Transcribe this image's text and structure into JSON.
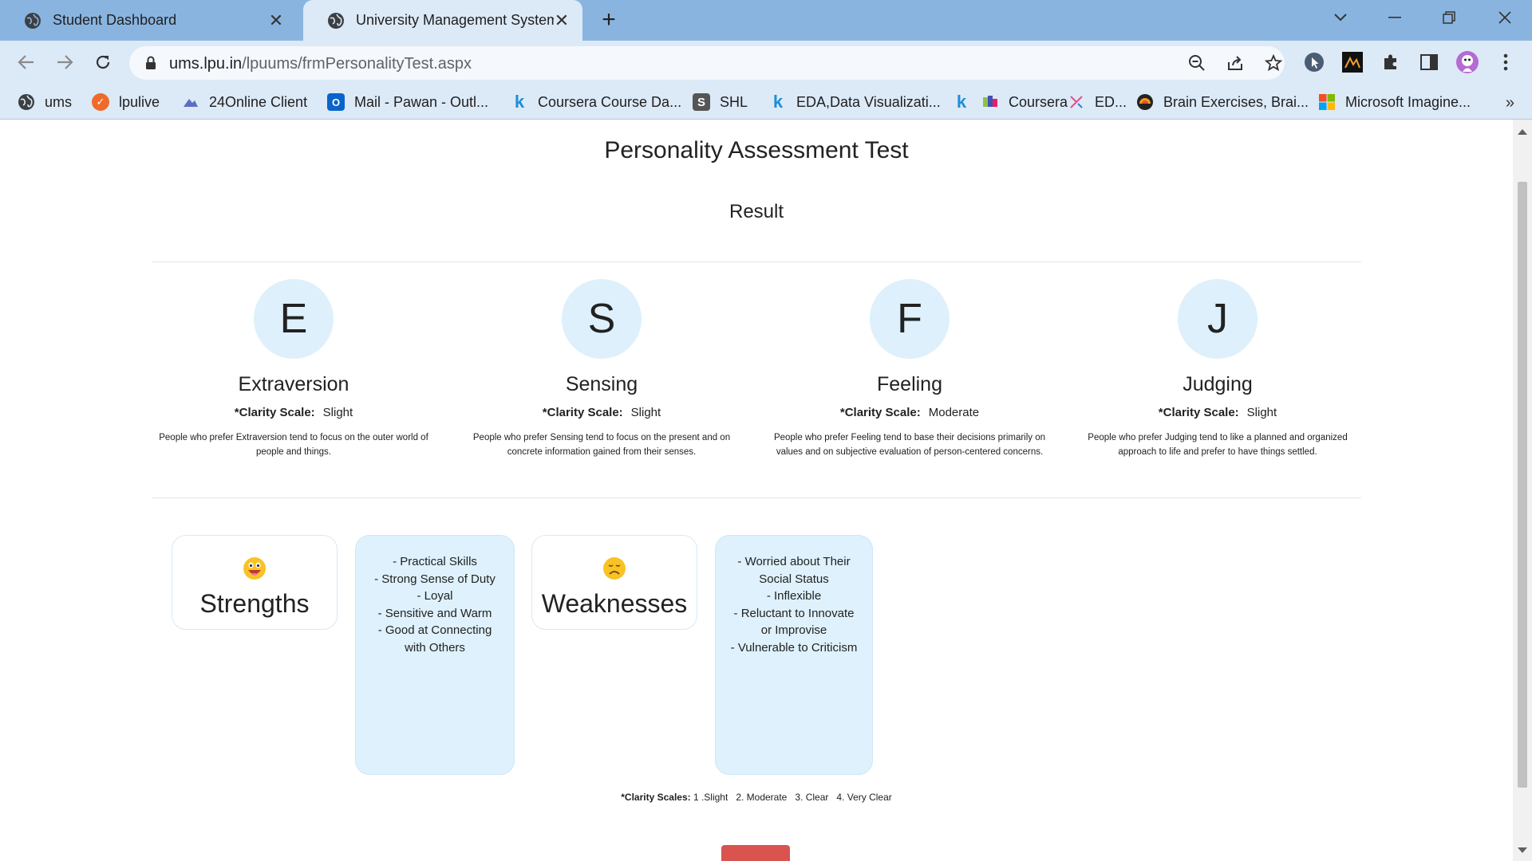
{
  "browser": {
    "tabs": [
      {
        "title": "Student Dashboard",
        "active": false
      },
      {
        "title": "University Management System - ",
        "active": true
      }
    ],
    "url_host": "ums.lpu.in",
    "url_path": "/lpuums/frmPersonalityTest.aspx",
    "bookmarks": [
      {
        "label": "ums",
        "icon": "globe-icon"
      },
      {
        "label": "lpulive",
        "icon": "lpulive-icon"
      },
      {
        "label": "24Online Client",
        "icon": "24online-icon"
      },
      {
        "label": "Mail - Pawan - Outl...",
        "icon": "outlook-icon"
      },
      {
        "label": "Coursera Course Da...",
        "icon": "kaggle-icon"
      },
      {
        "label": "SHL",
        "icon": "shl-icon"
      },
      {
        "label": "EDA,Data Visualizati...",
        "icon": "kaggle-icon"
      },
      {
        "label": "",
        "icon": "kaggle-icon"
      },
      {
        "label": "Coursera",
        "icon": "coursera-icon"
      },
      {
        "label": "ED...",
        "icon": "ed-icon"
      },
      {
        "label": "Brain Exercises, Brai...",
        "icon": "brain-icon"
      },
      {
        "label": "Microsoft Imagine...",
        "icon": "microsoft-icon"
      }
    ],
    "more": "»"
  },
  "page": {
    "title": "Personality Assessment Test",
    "result_heading": "Result",
    "clarity_label": "*Clarity Scale:",
    "traits": [
      {
        "letter": "E",
        "name": "Extraversion",
        "clarity": "Slight",
        "description": "People who prefer Extraversion tend to focus on the outer world of people and things."
      },
      {
        "letter": "S",
        "name": "Sensing",
        "clarity": "Slight",
        "description": "People who prefer Sensing tend to focus on the present and on concrete information gained from their senses."
      },
      {
        "letter": "F",
        "name": "Feeling",
        "clarity": "Moderate",
        "description": "People who prefer Feeling tend to base their decisions primarily on values and on subjective evaluation of person-centered concerns."
      },
      {
        "letter": "J",
        "name": "Judging",
        "clarity": "Slight",
        "description": "People who prefer Judging tend to like a planned and organized approach to life and prefer to have things settled."
      }
    ],
    "strengths": {
      "title": "Strengths",
      "items": [
        "- Practical Skills",
        "- Strong Sense of Duty",
        "- Loyal",
        "- Sensitive and Warm",
        "- Good at Connecting with Others"
      ]
    },
    "weaknesses": {
      "title": "Weaknesses",
      "items": [
        "- Worried about Their Social Status",
        "- Inflexible",
        "- Reluctant to Innovate or Improvise",
        "- Vulnerable to Criticism"
      ]
    },
    "clarity_scales_label": "*Clarity Scales:",
    "clarity_scales_text": " 1 .Slight   2. Moderate   3. Clear   4. Very Clear"
  },
  "colors": {
    "tabbar": "#8ab4e0",
    "toolbar": "#dce9f7",
    "circle": "#def0fb",
    "list_card": "#def1fc",
    "next_button": "#d9534f"
  }
}
